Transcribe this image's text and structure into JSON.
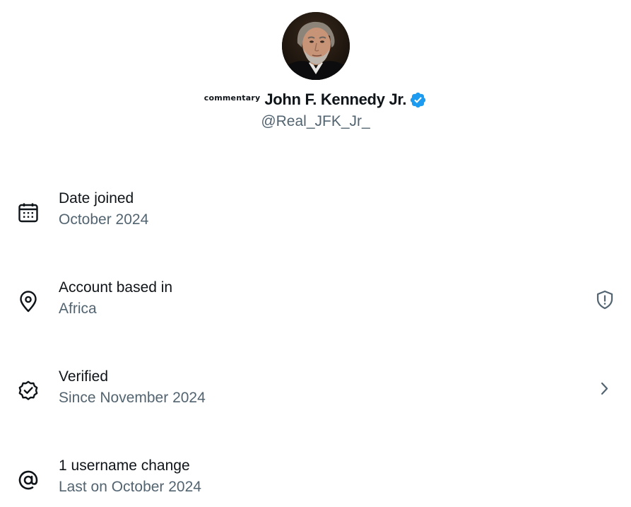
{
  "profile": {
    "name_prefix": "commentary",
    "display_name": "John F. Kennedy Jr.",
    "handle": "@Real_JFK_Jr_",
    "avatar_icon": "profile-avatar",
    "verified_icon": "verified-badge-icon",
    "verified_color": "#1d9bf0"
  },
  "details": [
    {
      "icon": "calendar-icon",
      "title": "Date joined",
      "subtitle": "October 2024"
    },
    {
      "icon": "location-pin-icon",
      "title": "Account based in",
      "subtitle": "Africa",
      "trailing_icon": "shield-alert-icon"
    },
    {
      "icon": "verified-check-icon",
      "title": "Verified",
      "subtitle": "Since November 2024",
      "trailing_icon": "chevron-right-icon"
    },
    {
      "icon": "at-sign-icon",
      "title": "1 username change",
      "subtitle": "Last on October 2024"
    }
  ],
  "colors": {
    "primary_text": "#0f1419",
    "secondary_text": "#536471",
    "background": "#ffffff"
  }
}
